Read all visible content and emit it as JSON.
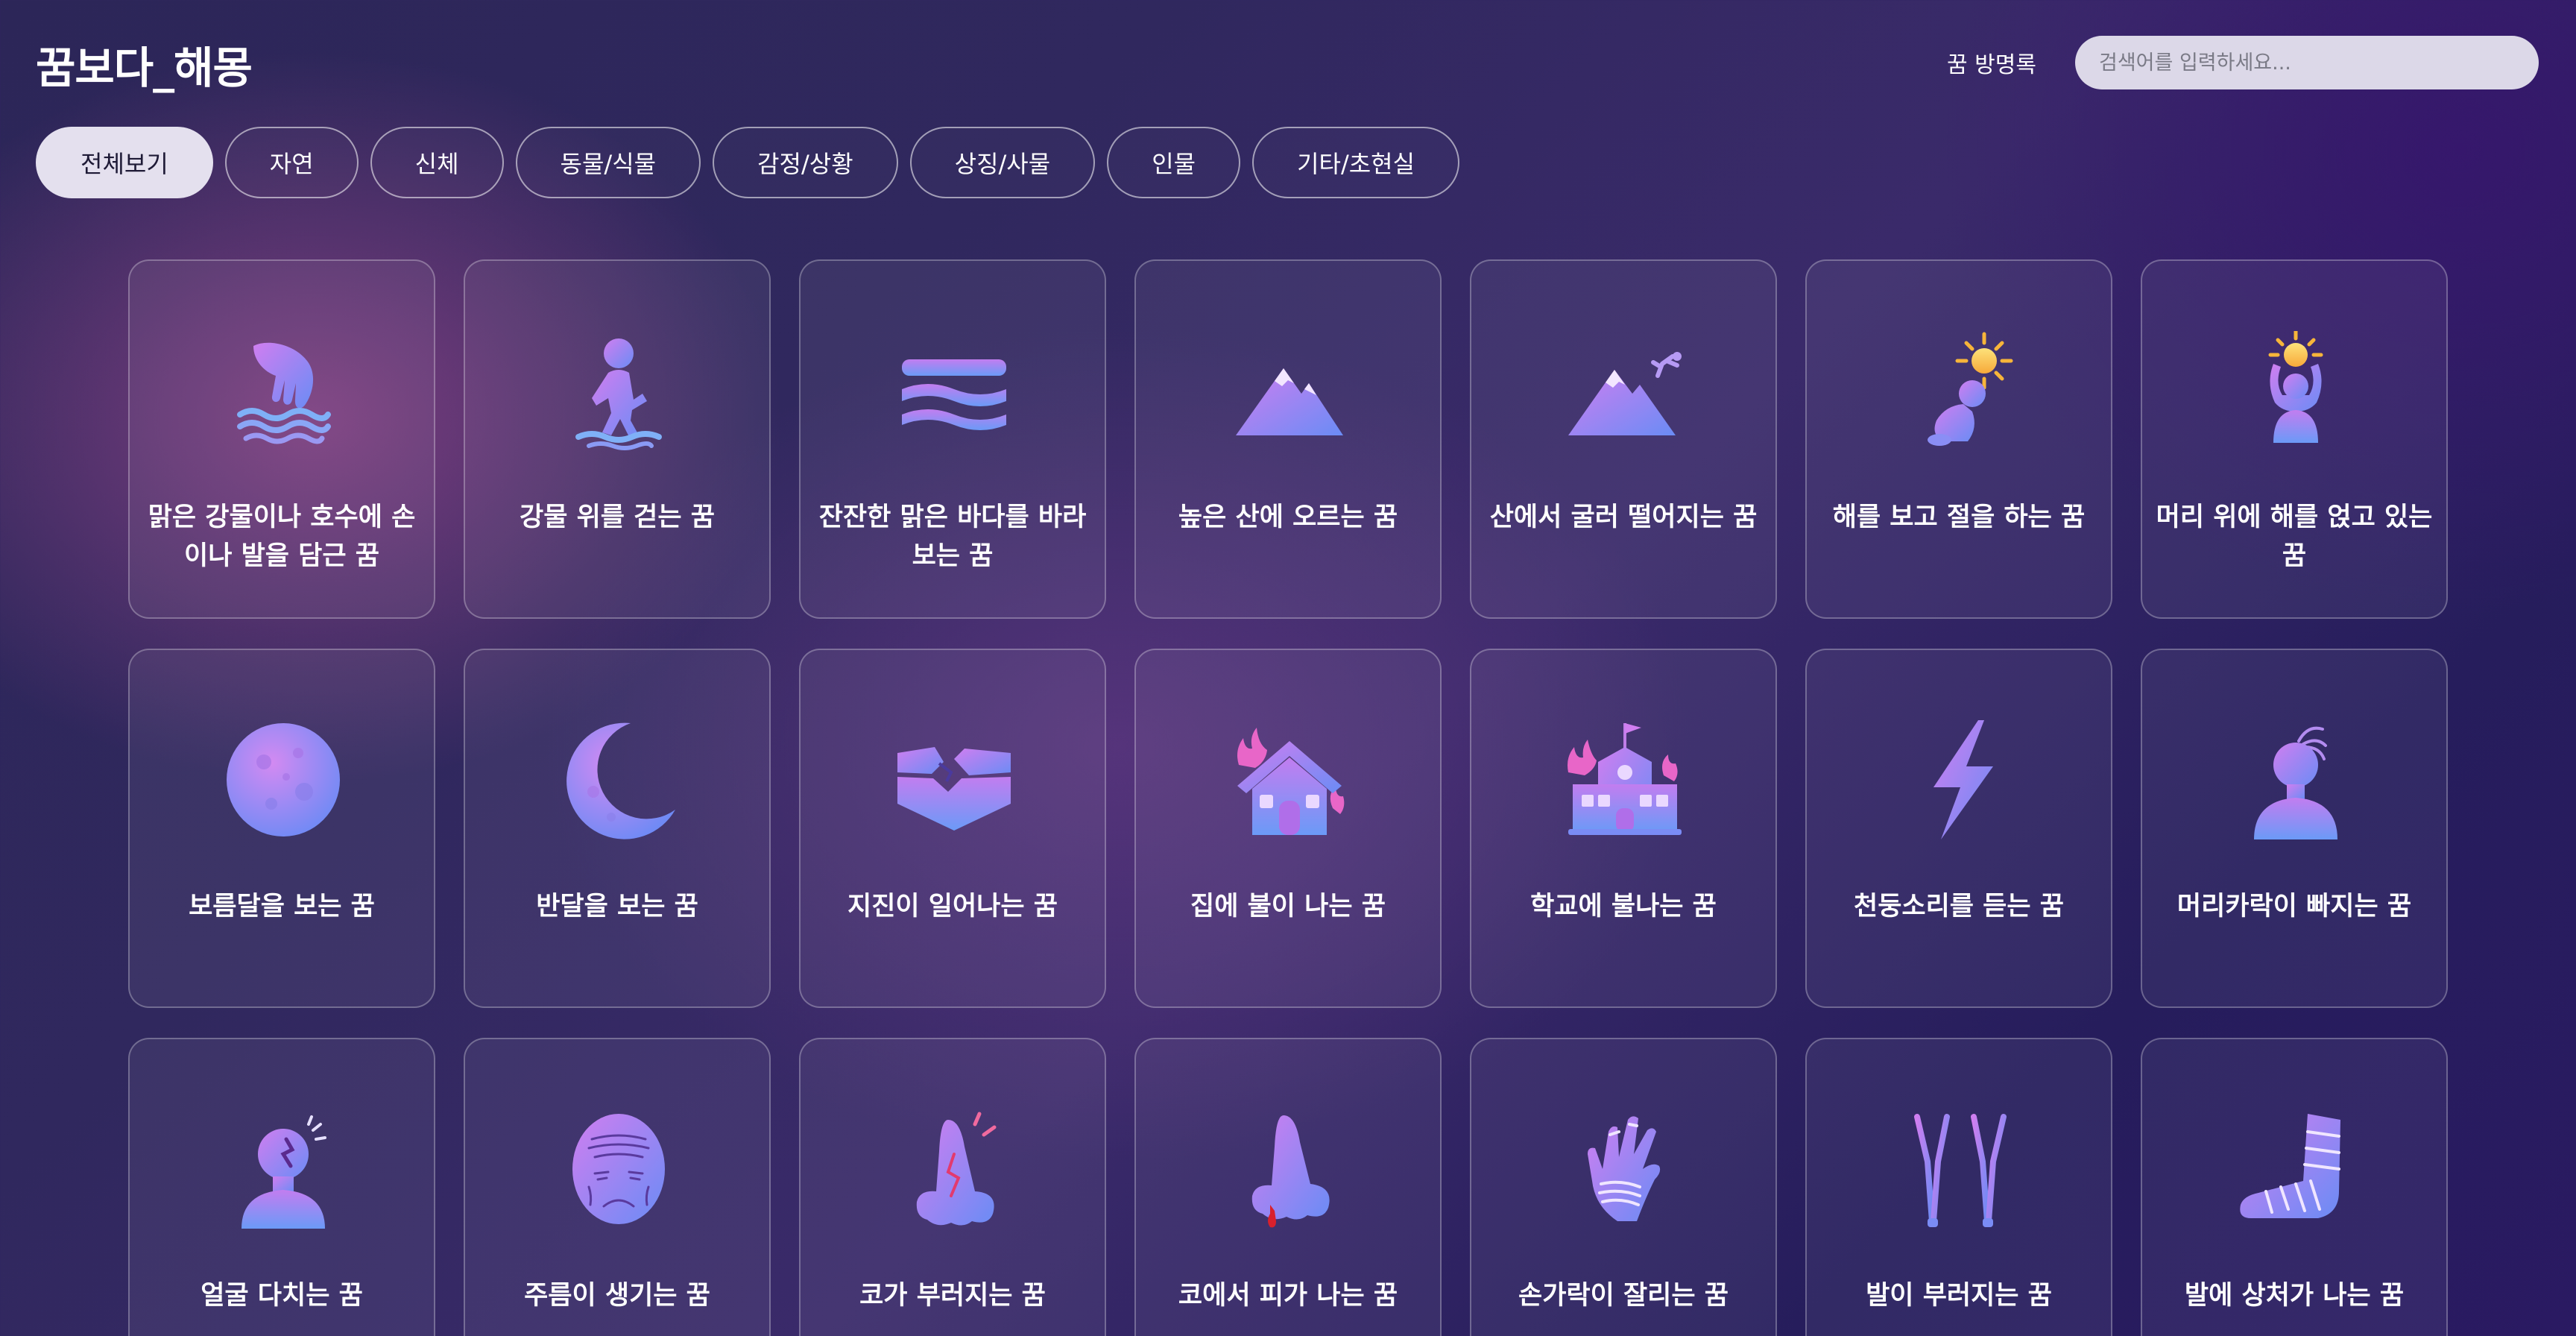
{
  "header": {
    "logo": "꿈보다_해몽",
    "guestbook_label": "꿈 방명록",
    "search_placeholder": "검색어를 입력하세요..."
  },
  "tabs": [
    {
      "label": "전체보기",
      "active": true
    },
    {
      "label": "자연"
    },
    {
      "label": "신체"
    },
    {
      "label": "동물/식물"
    },
    {
      "label": "감정/상황"
    },
    {
      "label": "상징/사물"
    },
    {
      "label": "인물"
    },
    {
      "label": "기타/초현실"
    }
  ],
  "cards": [
    {
      "label": "맑은 강물이나 호수에 손이나 발을 담근 꿈",
      "icon": "hand-in-water-icon"
    },
    {
      "label": "강물 위를 걷는 꿈",
      "icon": "walking-on-water-icon"
    },
    {
      "label": "잔잔한 맑은 바다를 바라보는 꿈",
      "icon": "calm-sea-icon"
    },
    {
      "label": "높은 산에 오르는 꿈",
      "icon": "mountain-icon"
    },
    {
      "label": "산에서 굴러 떨어지는 꿈",
      "icon": "falling-from-mountain-icon"
    },
    {
      "label": "해를 보고 절을 하는 꿈",
      "icon": "bowing-to-sun-icon"
    },
    {
      "label": "머리 위에 해를 얹고 있는 꿈",
      "icon": "sun-on-head-icon"
    },
    {
      "label": "보름달을 보는 꿈",
      "icon": "full-moon-icon"
    },
    {
      "label": "반달을 보는 꿈",
      "icon": "crescent-moon-icon"
    },
    {
      "label": "지진이 일어나는 꿈",
      "icon": "earthquake-icon"
    },
    {
      "label": "집에 불이 나는 꿈",
      "icon": "house-fire-icon"
    },
    {
      "label": "학교에 불나는 꿈",
      "icon": "school-fire-icon"
    },
    {
      "label": "천둥소리를 듣는 꿈",
      "icon": "lightning-icon"
    },
    {
      "label": "머리카락이 빠지는 꿈",
      "icon": "hair-loss-icon"
    },
    {
      "label": "얼굴 다치는 꿈",
      "icon": "injured-face-icon"
    },
    {
      "label": "주름이 생기는 꿈",
      "icon": "wrinkled-face-icon"
    },
    {
      "label": "코가 부러지는 꿈",
      "icon": "broken-nose-icon"
    },
    {
      "label": "코에서 피가 나는 꿈",
      "icon": "nosebleed-icon"
    },
    {
      "label": "손가락이 잘리는 꿈",
      "icon": "bandaged-hand-icon"
    },
    {
      "label": "발이 부러지는 꿈",
      "icon": "crutches-icon"
    },
    {
      "label": "발에 상처가 나는 꿈",
      "icon": "bandaged-foot-icon"
    }
  ],
  "colors": {
    "icon_gradient_start": "#c37ef0",
    "icon_gradient_end": "#6f8af5",
    "sun": "#f9c84a",
    "flame": "#e866c8",
    "blood": "#d8202c"
  }
}
